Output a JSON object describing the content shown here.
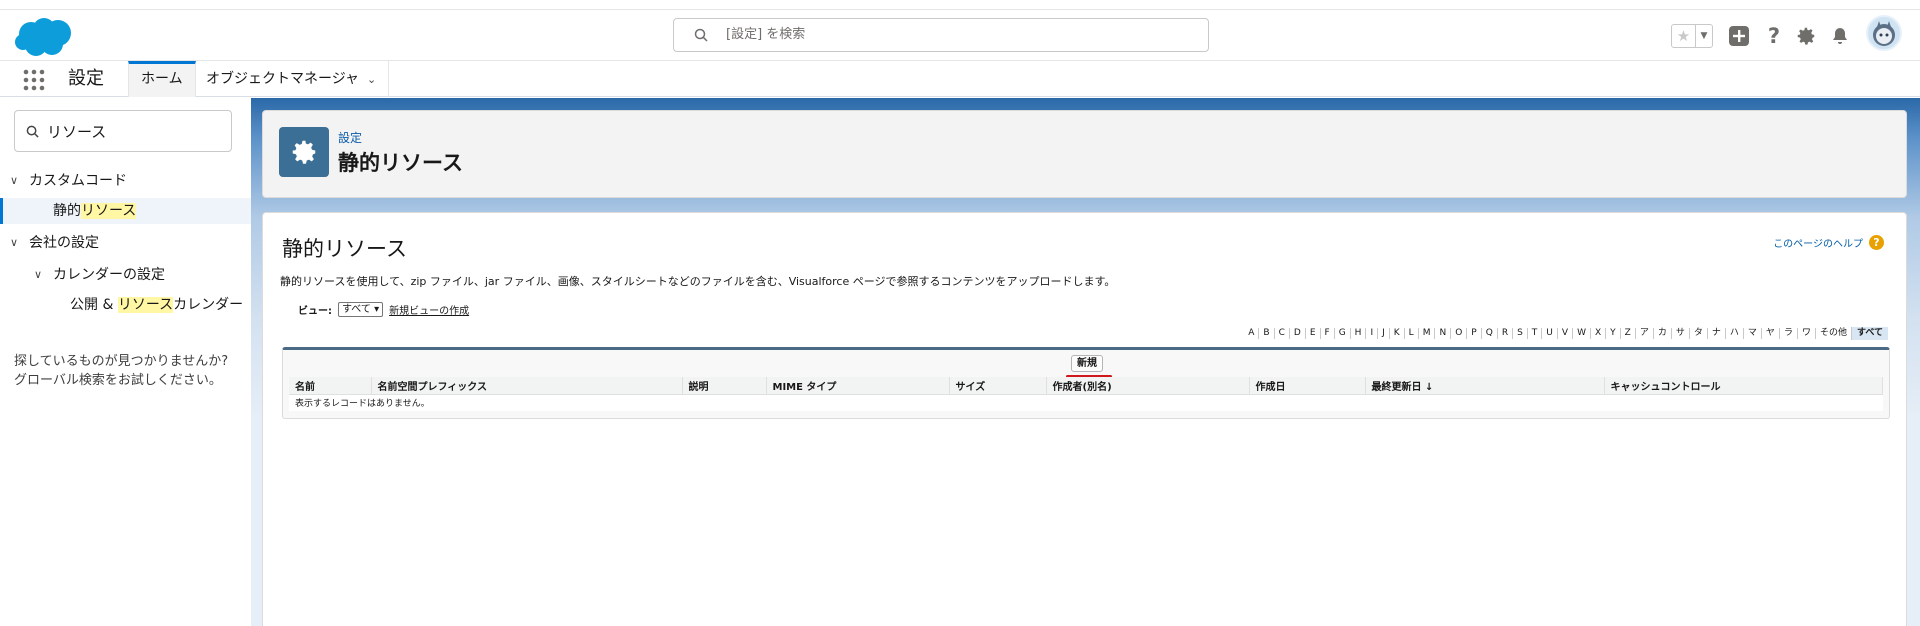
{
  "header": {
    "search_placeholder": "[設定] を検索"
  },
  "nav": {
    "app_name": "設定",
    "tabs": [
      {
        "label": "ホーム"
      },
      {
        "label": "オブジェクトマネージャ"
      }
    ]
  },
  "sidebar": {
    "search_value": "リソース",
    "custom_code": "カスタムコード",
    "item_static_pre": "静的",
    "item_static_hl": "リソース",
    "company_settings": "会社の設定",
    "calendar_settings": "カレンダーの設定",
    "pub_pre": "公開 & ",
    "pub_hl": "リソース",
    "pub_post": "カレンダー",
    "not_found_line1": "探しているものが見つかりませんか?",
    "not_found_line2": "グローバル検索をお試しください。"
  },
  "page_header": {
    "breadcrumb": "設定",
    "title": "静的リソース"
  },
  "content": {
    "title": "静的リソース",
    "help_link": "このページのヘルプ",
    "description": "静的リソースを使用して、zip ファイル、jar ファイル、画像、スタイルシートなどのファイルを含む、Visualforce ページで参照するコンテンツをアップロードします。",
    "view_label": "ビュー:",
    "view_selected": "すべて",
    "new_view_link": "新規ビューの作成",
    "alphabet": [
      "A",
      "B",
      "C",
      "D",
      "E",
      "F",
      "G",
      "H",
      "I",
      "J",
      "K",
      "L",
      "M",
      "N",
      "O",
      "P",
      "Q",
      "R",
      "S",
      "T",
      "U",
      "V",
      "W",
      "X",
      "Y",
      "Z",
      "ア",
      "カ",
      "サ",
      "タ",
      "ナ",
      "ハ",
      "マ",
      "ヤ",
      "ラ",
      "ワ",
      "その他",
      "すべて"
    ],
    "new_button": "新規",
    "columns": [
      "名前",
      "名前空間プレフィックス",
      "説明",
      "MIME タイプ",
      "サイズ",
      "作成者(別名)",
      "作成日",
      "最終更新日 ↓",
      "キャッシュコントロール"
    ],
    "empty_message": "表示するレコードはありません。"
  },
  "colors": {
    "brand": "#0176d3",
    "header_blue": "#2a68a8",
    "highlight": "#fff7a3",
    "accent_red": "#d0171b"
  }
}
